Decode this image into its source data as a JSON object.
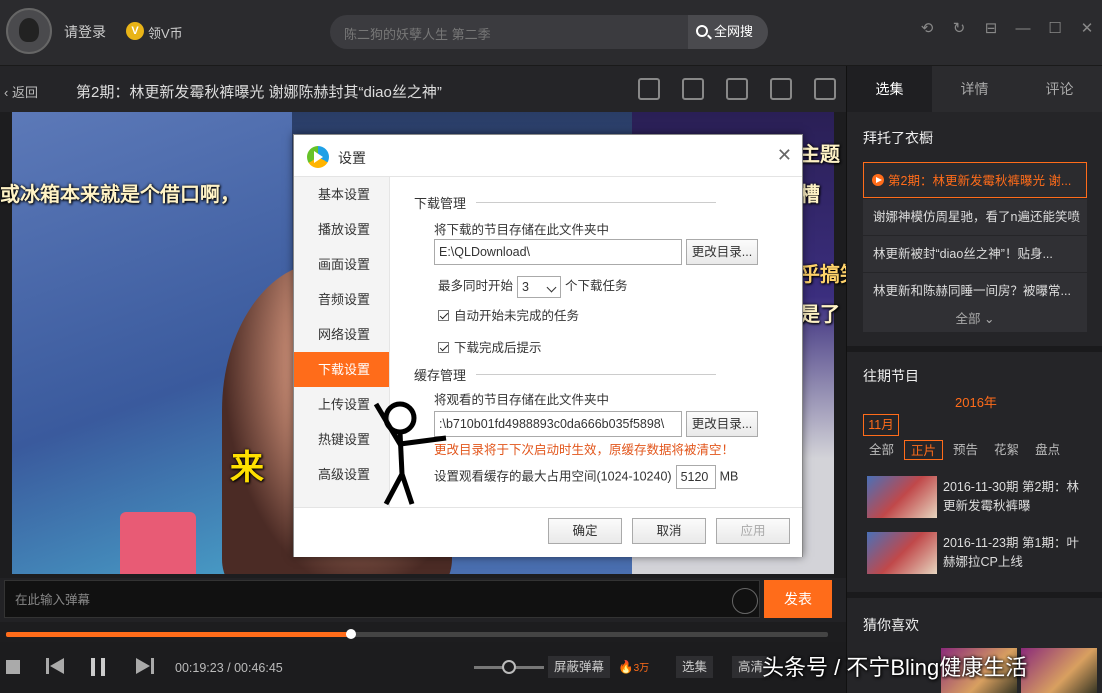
{
  "topbar": {
    "login": "请登录",
    "vcoin_icon": "V",
    "vcoin": "领V币",
    "search_placeholder": "陈二狗的妖孽人生 第二季",
    "search_button": "全网搜",
    "window_controls": [
      "history-icon",
      "refresh-icon",
      "menu-icon",
      "minimize-icon",
      "maximize-icon",
      "close-icon"
    ]
  },
  "titlebar": {
    "back": "返回",
    "title": "第2期：林更新发霉秋裤曝光 谢娜陈赫封其“diao丝之神”",
    "icons": [
      "mini-mode-icon",
      "download-icon",
      "favorite-icon",
      "share-icon",
      "screen-icon"
    ]
  },
  "video": {
    "subtitles": [
      "或冰箱本来就是个借口啊，",
      "主题",
      "槽",
      "乎搞笑",
      "是了",
      "来"
    ]
  },
  "dialog": {
    "title": "设置",
    "nav": [
      "基本设置",
      "播放设置",
      "画面设置",
      "音频设置",
      "网络设置",
      "下载设置",
      "上传设置",
      "热键设置",
      "高级设置"
    ],
    "active_nav": 5,
    "download": {
      "header": "下载管理",
      "store_label": "将下载的节目存储在此文件夹中",
      "path": "E:\\QLDownload\\",
      "change_dir": "更改目录...",
      "max_prefix": "最多同时开始",
      "max_value": "3",
      "max_suffix": "个下载任务",
      "auto_start": "自动开始未完成的任务",
      "notify": "下载完成后提示"
    },
    "cache": {
      "header": "缓存管理",
      "store_label": "将观看的节目存储在此文件夹中",
      "path": ":\\b710b01fd4988893c0da666b035f5898\\",
      "change_dir": "更改目录...",
      "warning": "更改目录将于下次启动时生效，原缓存数据将被清空！",
      "max_label": "设置观看缓存的最大占用空间(1024-10240)",
      "max_value": "5120",
      "unit": "MB"
    },
    "buttons": {
      "ok": "确定",
      "cancel": "取消",
      "apply": "应用"
    }
  },
  "danmu": {
    "placeholder": "在此输入弹幕",
    "send": "发表"
  },
  "player": {
    "progress": 0.42,
    "current_time": "00:19:23",
    "total_time": "00:46:45",
    "block_danmu": "屏蔽弹幕",
    "danmu_count": "3万",
    "episodes": "选集",
    "quality": "高清"
  },
  "sidebar": {
    "tabs": [
      "选集",
      "详情",
      "评论"
    ],
    "show_title": "拜托了衣橱",
    "episodes": [
      "第2期：林更新发霉秋裤曝光 谢...",
      "谢娜神模仿周星驰，看了n遍还能笑喷",
      "林更新被封“diao丝之神”！贴身...",
      "林更新和陈赫同睡一间房？被曝常..."
    ],
    "all": "全部",
    "past_title": "往期节目",
    "year": "2016年",
    "month": "11月",
    "filters": [
      "全部",
      "正片",
      "预告",
      "花絮",
      "盘点"
    ],
    "active_filter": 1,
    "past": [
      "2016-11-30期 第2期：林更新发霉秋裤曝",
      "2016-11-23期 第1期：叶赫娜拉CP上线"
    ],
    "guess_title": "猜你喜欢"
  },
  "watermark": "头条号 / 不宁Bling健康生活"
}
